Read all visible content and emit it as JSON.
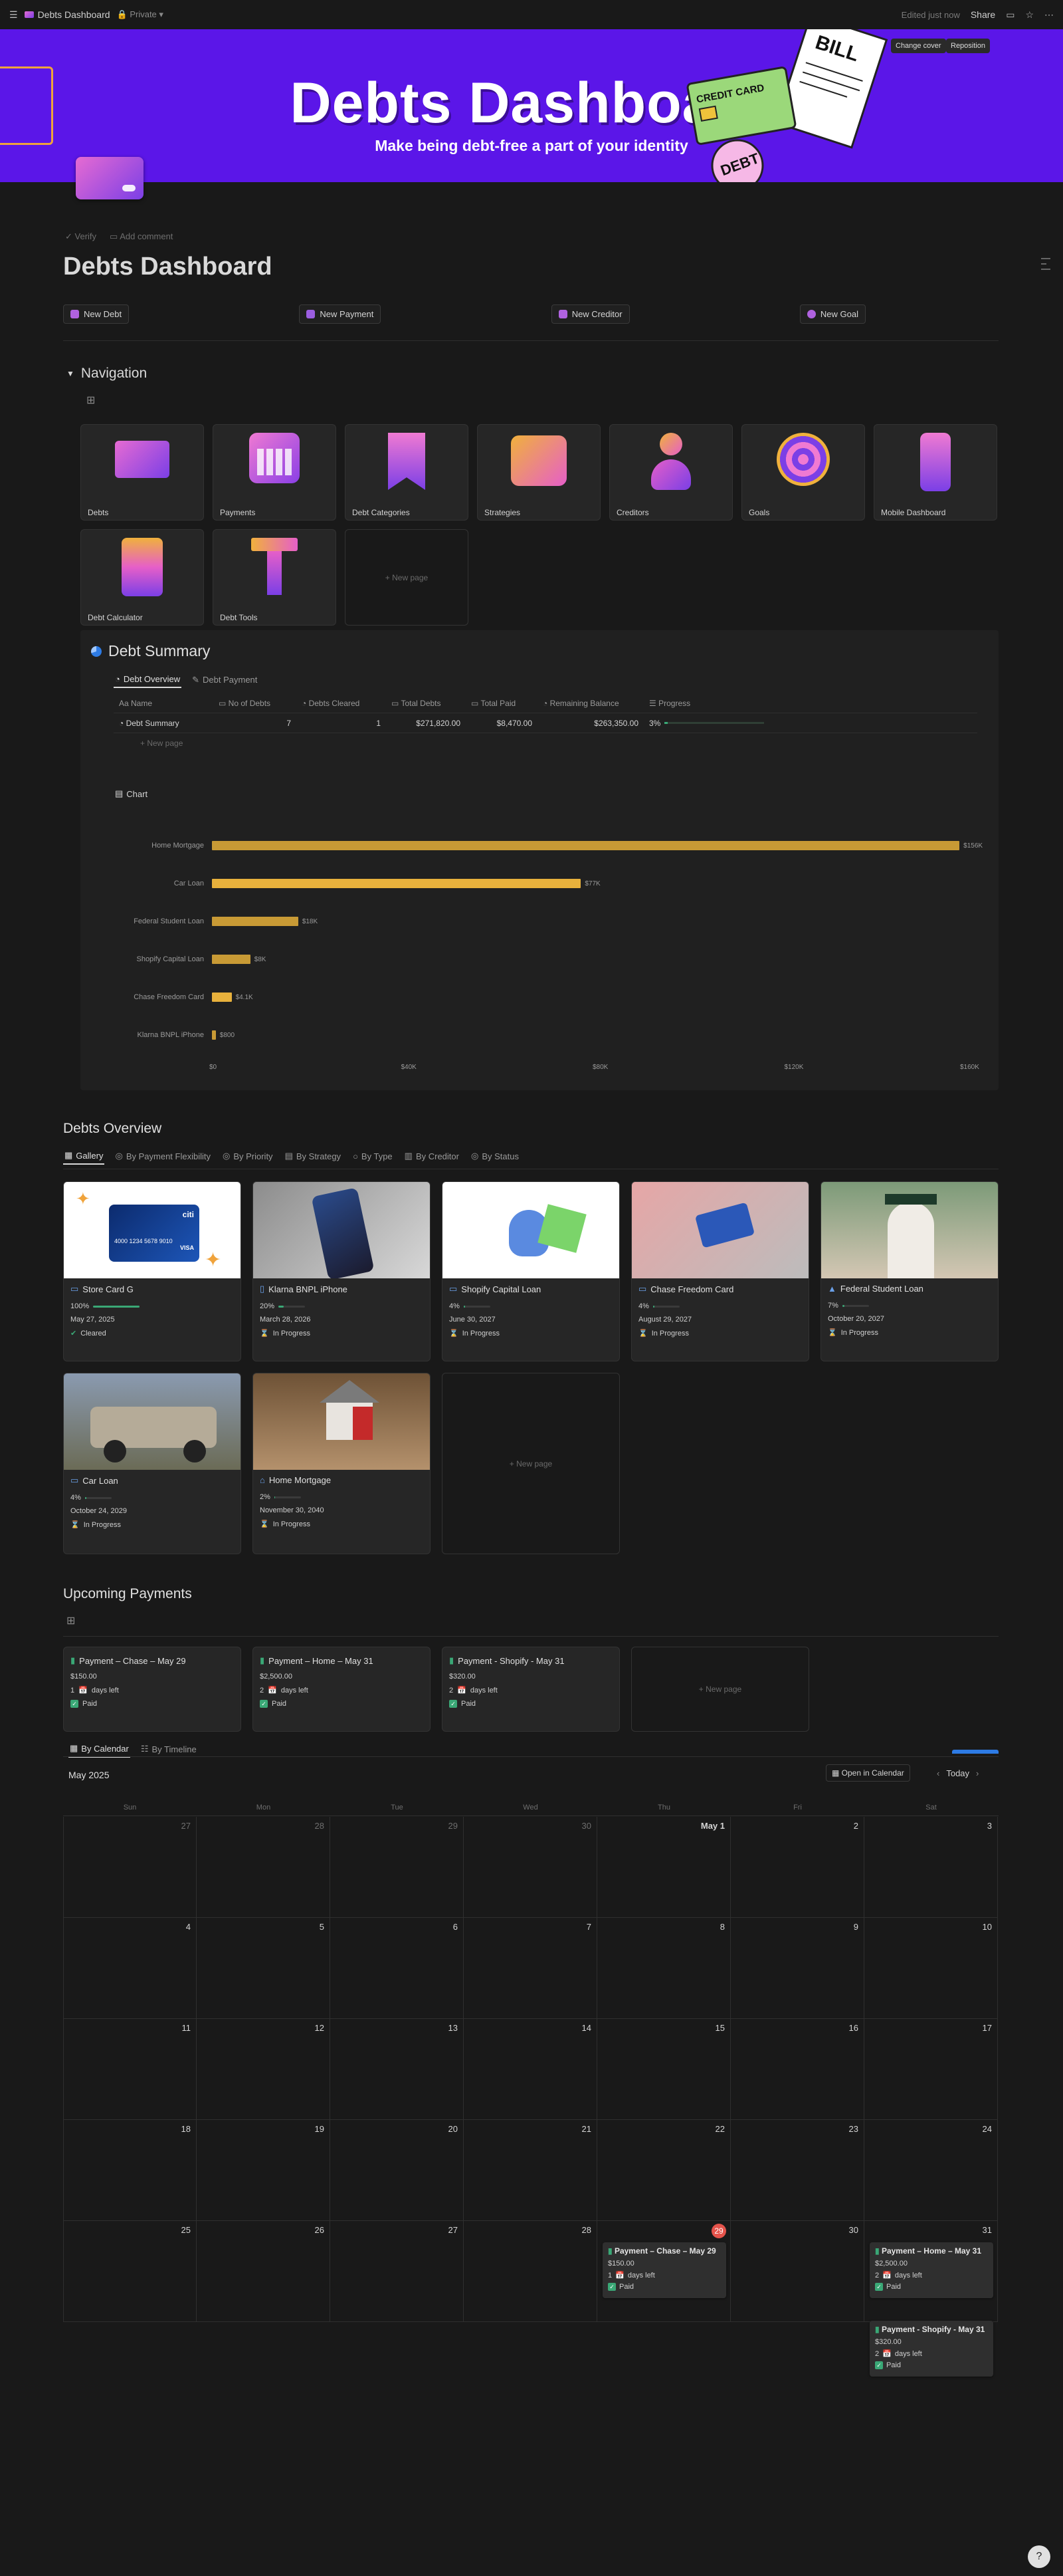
{
  "topbar": {
    "title": "Debts Dashboard",
    "privacy": "Private",
    "edited": "Edited just now",
    "share": "Share"
  },
  "cover": {
    "title": "Debts Dashboard",
    "subtitle": "Make being debt-free a part of your identity",
    "change_cover": "Change cover",
    "reposition": "Reposition",
    "art_credit_card": "CREDIT CARD",
    "art_bill": "BILL",
    "art_debt": "DEBT"
  },
  "meta": {
    "verify": "Verify",
    "add_comment": "Add comment"
  },
  "page_title": "Debts Dashboard",
  "actions": [
    "New Debt",
    "New Payment",
    "New Creditor",
    "New Goal"
  ],
  "navigation": {
    "heading": "Navigation",
    "cards": [
      "Debts",
      "Payments",
      "Debt Categories",
      "Strategies",
      "Creditors",
      "Goals",
      "Mobile Dashboard",
      "Debt Calculator",
      "Debt Tools"
    ],
    "new_page": "New page"
  },
  "debt_summary": {
    "heading": "Debt Summary",
    "tabs": [
      "Debt Overview",
      "Debt Payment"
    ],
    "columns": [
      "Name",
      "No of Debts",
      "Debts Cleared",
      "Total Debts",
      "Total Paid",
      "Remaining Balance",
      "Progress"
    ],
    "row": {
      "name": "Debt Summary",
      "no_of_debts": "7",
      "debts_cleared": "1",
      "total_debts": "$271,820.00",
      "total_paid": "$8,470.00",
      "remaining": "$263,350.00",
      "progress": "3%",
      "progress_value": 0.03
    },
    "new_page": "New page",
    "chart_tab": "Chart"
  },
  "chart_data": {
    "type": "bar",
    "orientation": "horizontal",
    "categories": [
      "Home Mortgage",
      "Car Loan",
      "Federal Student Loan",
      "Shopify Capital Loan",
      "Chase Freedom Card",
      "Klarna BNPL iPhone"
    ],
    "values": [
      156000,
      77000,
      18000,
      8000,
      4100,
      800
    ],
    "value_labels": [
      "$156K",
      "$77K",
      "$18K",
      "$8K",
      "$4.1K",
      "$800"
    ],
    "xticks": [
      "$0",
      "$40K",
      "$80K",
      "$120K",
      "$160K"
    ],
    "xlim": [
      0,
      160000
    ],
    "colors": [
      "#c89a35",
      "#e8b13c",
      "#c89a35",
      "#c89a35",
      "#e8b13c",
      "#c89a35"
    ]
  },
  "debts_overview": {
    "heading": "Debts Overview",
    "tabs": [
      "Gallery",
      "By Payment Flexibility",
      "By Priority",
      "By Strategy",
      "By Type",
      "By Creditor",
      "By Status"
    ],
    "cards": [
      {
        "name": "Store Card G",
        "pct": "100%",
        "pct_value": 1.0,
        "date": "May 27, 2025",
        "status": "Cleared",
        "img_card_brand": "citi",
        "img_card_number": "4000 1234 5678 9010",
        "img_card_network": "VISA"
      },
      {
        "name": "Klarna BNPL iPhone",
        "pct": "20%",
        "pct_value": 0.2,
        "date": "March 28, 2026",
        "status": "In Progress"
      },
      {
        "name": "Shopify Capital Loan",
        "pct": "4%",
        "pct_value": 0.04,
        "date": "June 30, 2027",
        "status": "In Progress"
      },
      {
        "name": "Chase Freedom Card",
        "pct": "4%",
        "pct_value": 0.04,
        "date": "August 29, 2027",
        "status": "In Progress"
      },
      {
        "name": "Federal Student Loan",
        "pct": "7%",
        "pct_value": 0.07,
        "date": "October 20, 2027",
        "status": "In Progress"
      },
      {
        "name": "Car Loan",
        "pct": "4%",
        "pct_value": 0.04,
        "date": "October 24, 2029",
        "status": "In Progress"
      },
      {
        "name": "Home Mortgage",
        "pct": "2%",
        "pct_value": 0.02,
        "date": "November 30, 2040",
        "status": "In Progress"
      }
    ],
    "new_page": "New page"
  },
  "upcoming": {
    "heading": "Upcoming Payments",
    "cards": [
      {
        "name": "Payment – Chase – May 29",
        "amount": "$150.00",
        "days": "1",
        "days_label": "days left",
        "status": "Paid"
      },
      {
        "name": "Payment – Home – May 31",
        "amount": "$2,500.00",
        "days": "2",
        "days_label": "days left",
        "status": "Paid"
      },
      {
        "name": "Payment - Shopify - May 31",
        "amount": "$320.00",
        "days": "2",
        "days_label": "days left",
        "status": "Paid"
      }
    ],
    "new_page": "New page",
    "tabs": [
      "By Calendar",
      "By Timeline"
    ]
  },
  "calendar": {
    "month": "May 2025",
    "open_in_calendar": "Open in Calendar",
    "today": "Today",
    "dow": [
      "Sun",
      "Mon",
      "Tue",
      "Wed",
      "Thu",
      "Fri",
      "Sat"
    ],
    "weeks": [
      [
        "27",
        "28",
        "29",
        "30",
        "May 1",
        "2",
        "3"
      ],
      [
        "4",
        "5",
        "6",
        "7",
        "8",
        "9",
        "10"
      ],
      [
        "11",
        "12",
        "13",
        "14",
        "15",
        "16",
        "17"
      ],
      [
        "18",
        "19",
        "20",
        "21",
        "22",
        "23",
        "24"
      ],
      [
        "25",
        "26",
        "27",
        "28",
        "29",
        "30",
        "31"
      ]
    ],
    "events": {
      "thu29": {
        "name": "Payment – Chase – May 29",
        "amount": "$150.00",
        "days": "1",
        "days_label": "days left",
        "status": "Paid"
      },
      "sat31a": {
        "name": "Payment – Home – May 31",
        "amount": "$2,500.00",
        "days": "2",
        "days_label": "days left",
        "status": "Paid"
      },
      "sat31b": {
        "name": "Payment - Shopify - May 31",
        "amount": "$320.00",
        "days": "2",
        "days_label": "days left",
        "status": "Paid"
      }
    }
  },
  "colors": {
    "cover": "#5b16e8",
    "bar": "#e8b13c",
    "bar_dark": "#c89a35",
    "progress": "#3aa876",
    "today": "#e5534b",
    "accent_blue": "#2d7be5"
  }
}
